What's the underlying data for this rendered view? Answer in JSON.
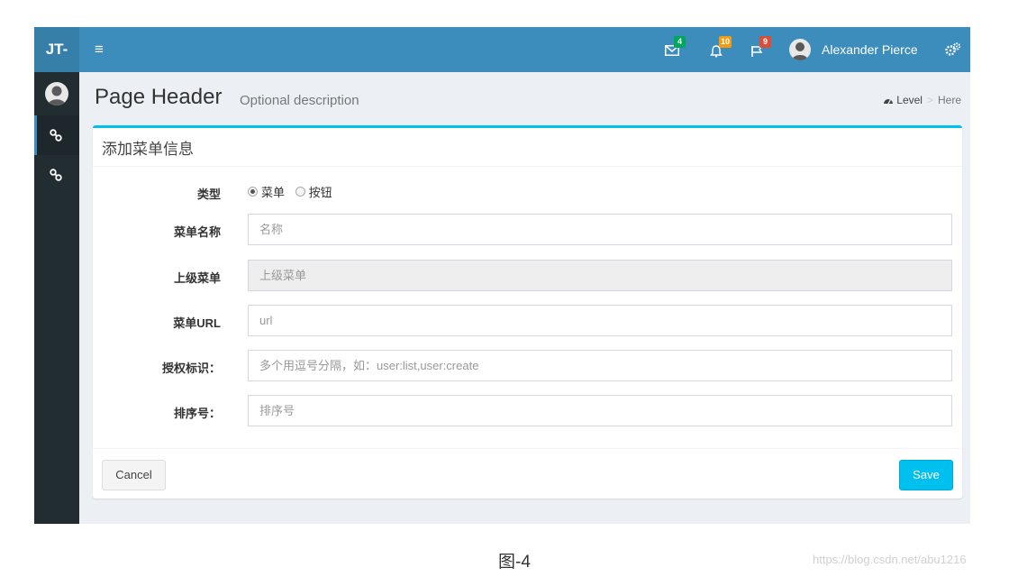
{
  "app": {
    "logo": "JT-"
  },
  "navbar": {
    "toggle_icon": "hamburger-icon",
    "messages": {
      "icon": "envelope-icon",
      "count": "4",
      "color": "#00a65a"
    },
    "notifications": {
      "icon": "bell-icon",
      "count": "10",
      "color": "#f39c12"
    },
    "tasks": {
      "icon": "flag-icon",
      "count": "9",
      "color": "#dd4b39"
    },
    "user_name": "Alexander Pierce",
    "settings_icon": "gears-icon"
  },
  "sidebar": {
    "items": [
      {
        "icon": "link-icon",
        "active": true
      },
      {
        "icon": "link-icon",
        "active": false
      }
    ]
  },
  "header": {
    "title": "Page Header",
    "description": "Optional description",
    "breadcrumb": {
      "level": "Level",
      "separator": ">",
      "here": "Here"
    }
  },
  "form": {
    "title": "添加菜单信息",
    "type": {
      "label": "类型",
      "options": [
        "菜单",
        "按钮"
      ],
      "selected": "菜单"
    },
    "menu_name": {
      "label": "菜单名称",
      "placeholder": "名称"
    },
    "parent_menu": {
      "label": "上级菜单",
      "placeholder": "上级菜单"
    },
    "menu_url": {
      "label": "菜单URL",
      "placeholder": "url"
    },
    "permission": {
      "label": "授权标识：",
      "placeholder": "多个用逗号分隔，如：user:list,user:create"
    },
    "sort_order": {
      "label": "排序号：",
      "placeholder": "排序号"
    },
    "cancel_label": "Cancel",
    "save_label": "Save"
  },
  "caption": "图-4",
  "watermark": "https://blog.csdn.net/abu1216",
  "colors": {
    "primary": "#3c8dbc",
    "info": "#00c0ef",
    "sidebar": "#222d32"
  }
}
